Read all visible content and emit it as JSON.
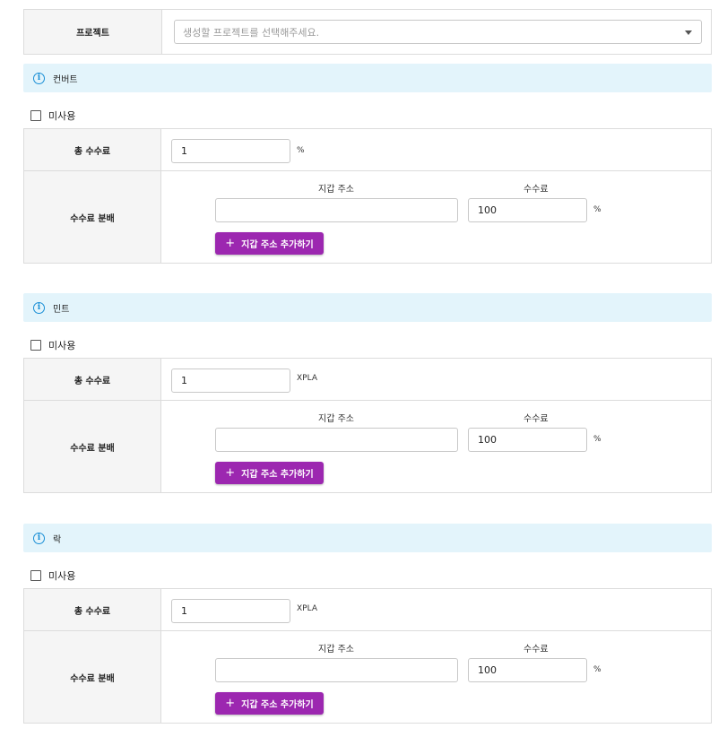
{
  "project": {
    "label": "프로젝트",
    "placeholder": "생성할 프로젝트를 선택해주세요."
  },
  "sections": [
    {
      "title": "컨버트",
      "checkbox_label": "미사용",
      "total_fee_label": "총 수수료",
      "total_fee_value": "1",
      "total_fee_unit": "%",
      "distribution_label": "수수료 분배",
      "wallet_header": "지갑 주소",
      "fee_header": "수수료",
      "wallet_value": "",
      "fee_value": "100",
      "fee_unit": "%",
      "add_button_label": "지갑 주소 추가하기"
    },
    {
      "title": "민트",
      "checkbox_label": "미사용",
      "total_fee_label": "총 수수료",
      "total_fee_value": "1",
      "total_fee_unit": "XPLA",
      "distribution_label": "수수료 분배",
      "wallet_header": "지갑 주소",
      "fee_header": "수수료",
      "wallet_value": "",
      "fee_value": "100",
      "fee_unit": "%",
      "add_button_label": "지갑 주소 추가하기"
    },
    {
      "title": "락",
      "checkbox_label": "미사용",
      "total_fee_label": "총 수수료",
      "total_fee_value": "1",
      "total_fee_unit": "XPLA",
      "distribution_label": "수수료 분배",
      "wallet_header": "지갑 주소",
      "fee_header": "수수료",
      "wallet_value": "",
      "fee_value": "100",
      "fee_unit": "%",
      "add_button_label": "지갑 주소 추가하기"
    }
  ],
  "icons": {
    "info": "info-circle-icon",
    "caret": "chevron-down-icon",
    "plus": "plus-icon"
  },
  "colors": {
    "info_bar_bg": "#e3f4fb",
    "info_icon": "#1a8fd6",
    "add_button_bg": "#9c27b0"
  }
}
